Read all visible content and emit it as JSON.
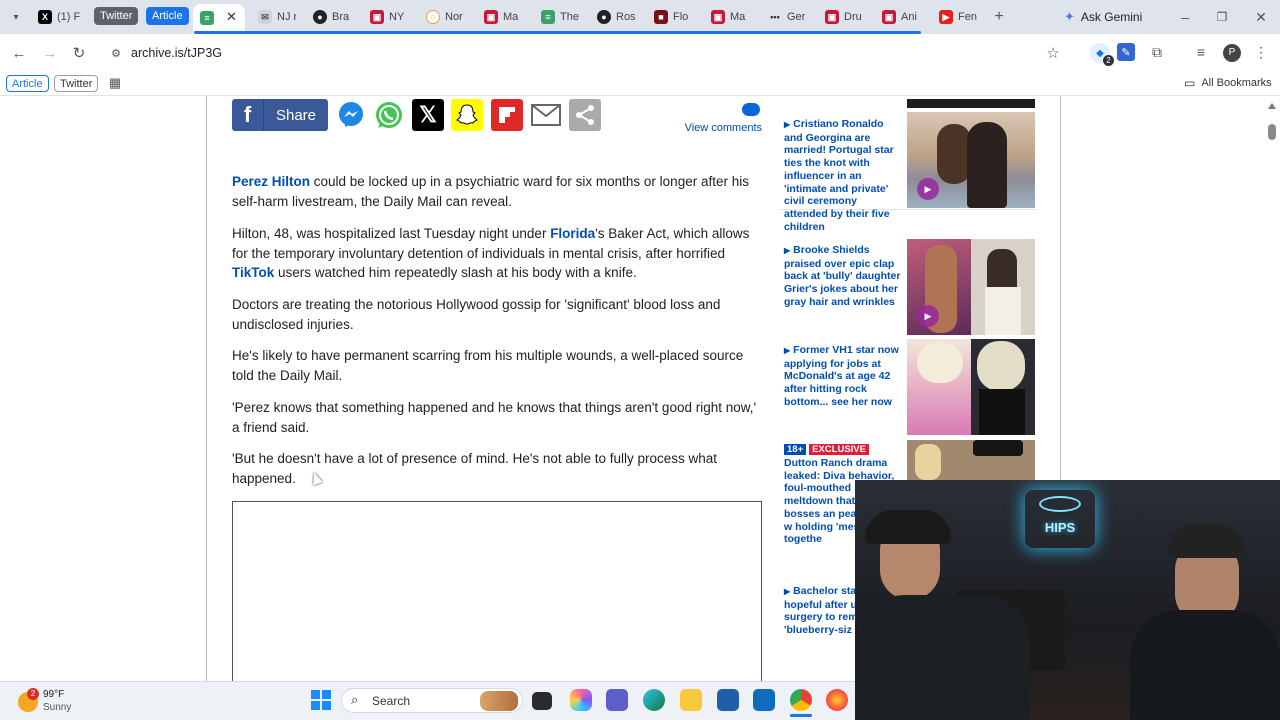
{
  "browser": {
    "tabs": [
      {
        "label": "(1) F",
        "icon": "x-logo-icon"
      },
      {
        "label": "Twitter",
        "pill": true
      },
      {
        "label": "Article",
        "pill": true
      },
      {
        "label": "",
        "active": true
      },
      {
        "label": "NJ r"
      },
      {
        "label": "Bra"
      },
      {
        "label": "NY"
      },
      {
        "label": "Nor"
      },
      {
        "label": "Ma"
      },
      {
        "label": "The"
      },
      {
        "label": "Ros"
      },
      {
        "label": "Flo"
      },
      {
        "label": "Ma"
      },
      {
        "label": "Ger"
      },
      {
        "label": "Dru"
      },
      {
        "label": "Ani"
      },
      {
        "label": "Fen"
      }
    ],
    "ask_gemini": "Ask Gemini",
    "url": "archive.is/tJP3G",
    "extension_badge": "2",
    "profile_initial": "P",
    "bookmarks": {
      "article": "Article",
      "twitter": "Twitter",
      "all_bookmarks": "All Bookmarks"
    }
  },
  "article": {
    "share_label": "Share",
    "view_comments": "View comments",
    "paragraphs": {
      "p1_link": "Perez Hilton",
      "p1_rest": " could be locked up in a psychiatric ward for six months or longer after his self-harm livestream, the Daily Mail can reveal.",
      "p2_a": "Hilton, 48, was hospitalized last Tuesday night under ",
      "p2_link1": "Florida",
      "p2_b": "'s Baker Act, which allows for the temporary involuntary detention of individuals in mental crisis, after horrified ",
      "p2_link2": "TikTok",
      "p2_c": " users watched him repeatedly slash at his body with a knife.",
      "p3": "Doctors are treating the notorious Hollywood gossip for 'significant' blood loss and undisclosed injuries.",
      "p4": "He's likely to have permanent scarring from his multiple wounds, a well-placed source told the Daily Mail.",
      "p5": "'Perez knows that something happened and he knows that things aren't good right now,' a friend said.",
      "p6": "'But he doesn't have a lot of presence of mind. He's not able to fully process what happened."
    }
  },
  "sidebar": [
    {
      "text": "Cristiano Ronaldo and Georgina are married! Portugal star ties the knot with influencer in an 'intimate and private' civil ceremony attended by their five children",
      "video": true
    },
    {
      "text": "Brooke Shields praised over epic clap back at 'bully' daughter Grier's jokes about her gray hair and wrinkles",
      "video": true
    },
    {
      "text": "Former VH1 star now applying for jobs at McDonald's at age 42 after hitting rock bottom... see her now",
      "video": false
    },
    {
      "badge1": "18+",
      "badge2": "EXCLUSIVE",
      "text": "Dutton Ranch drama leaked: Diva behavior, foul-mouthed meltdown that 'off' bosses an peacemaker w holding 'mess show' togethe"
    },
    {
      "text": "Bachelor star shares hopeful after undergoi surgery to rem 'blueberry-siz"
    }
  ],
  "taskbar": {
    "weather_temp": "99°F",
    "weather_desc": "Sunny",
    "weather_badge": "2",
    "search_label": "Search"
  },
  "webcam": {
    "neon_sign": "HIPS"
  },
  "colors": {
    "link": "#004db3",
    "facebook": "#3b5998",
    "twitter_pill": "#5f6368",
    "article_pill": "#1a73e8"
  }
}
